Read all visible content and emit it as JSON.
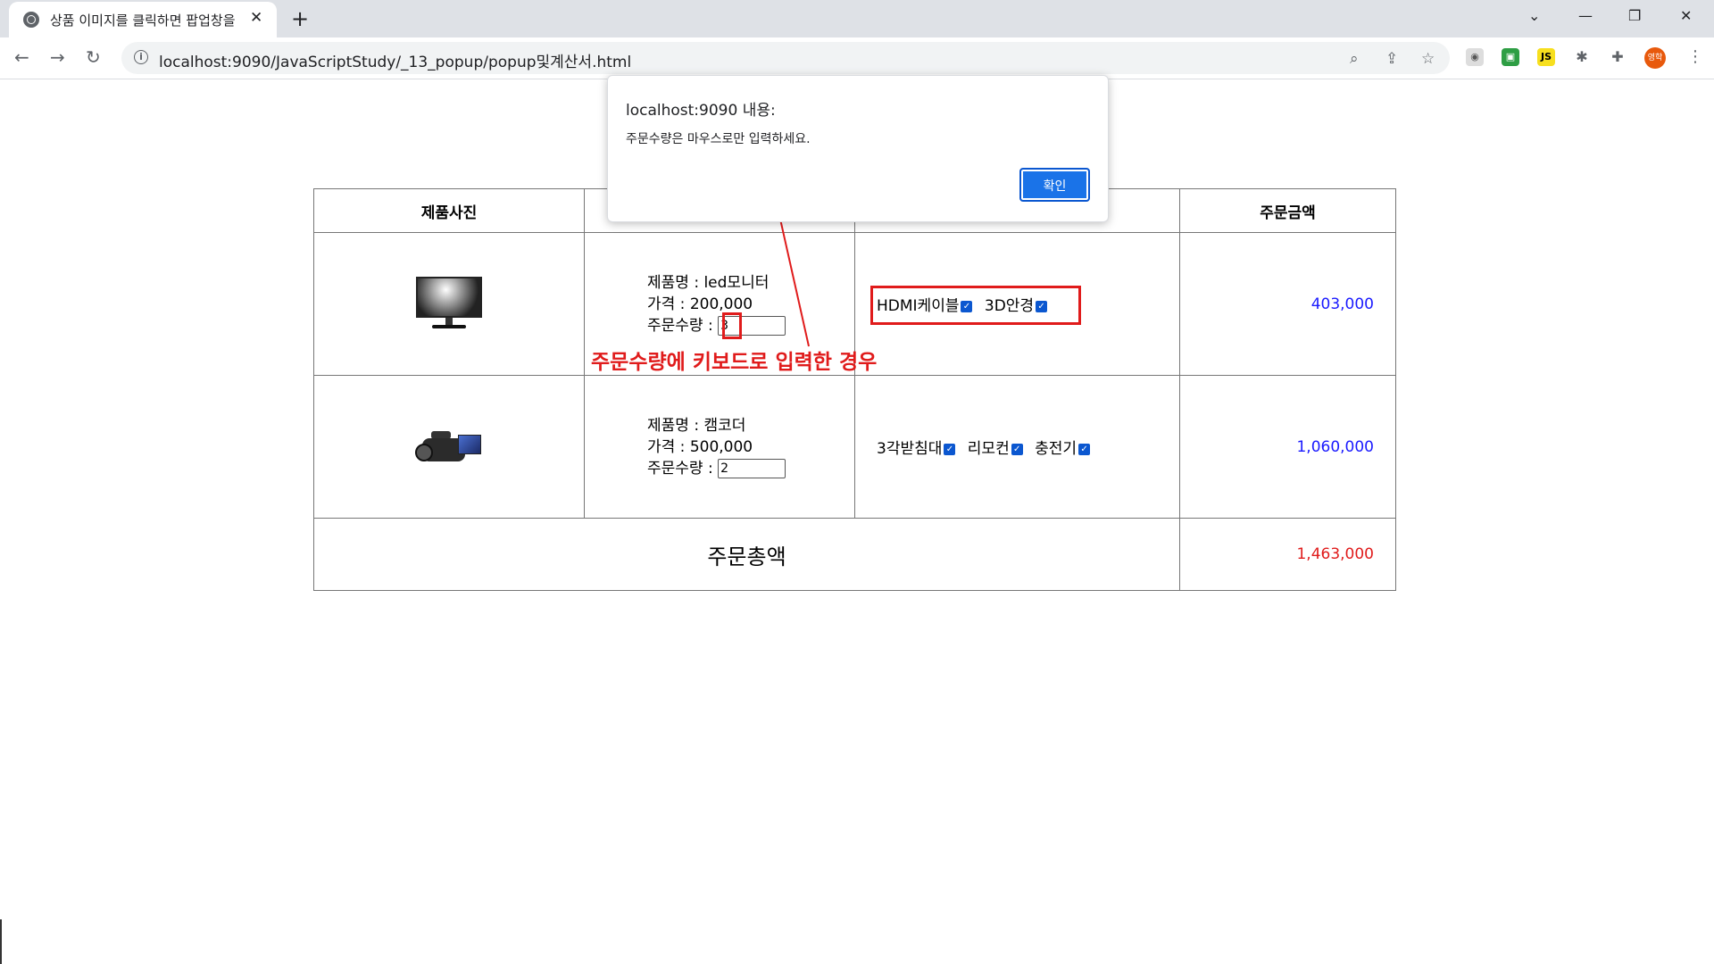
{
  "browser": {
    "tab_title": "상품 이미지를 클릭하면 팝업창을",
    "tab_close": "✕",
    "new_tab": "+",
    "url": "localhost:9090/JavaScriptStudy/_13_popup/popup및계산서.html",
    "window_controls": [
      "⌄",
      "—",
      "❐",
      "✕"
    ],
    "nav": {
      "back": "←",
      "forward": "→",
      "reload": "↻"
    },
    "profile_label": "영학",
    "extensions": [
      "ext-shield",
      "ext-green",
      "JS",
      "ext-bug",
      "puzzle-icon"
    ]
  },
  "dialog": {
    "title": "localhost:9090 내용:",
    "message": "주문수량은 마우스로만 입력하세요.",
    "ok_label": "확인"
  },
  "table": {
    "headers": [
      "제품사진",
      "",
      "",
      "주문금액"
    ],
    "rows": [
      {
        "image_icon": "monitor-icon",
        "name_line": "제품명 : led모니터",
        "price_line": "가격 : 200,000",
        "qty_label": "주문수량 :",
        "qty_value": "3",
        "options": [
          {
            "label": "HDMI케이블",
            "checked": true
          },
          {
            "label": "3D안경",
            "checked": true
          }
        ],
        "amount": "403,000"
      },
      {
        "image_icon": "camcorder-icon",
        "name_line": "제품명 : 캠코더",
        "price_line": "가격 : 500,000",
        "qty_label": "주문수량 :",
        "qty_value": "2",
        "options": [
          {
            "label": "3각받침대",
            "checked": true
          },
          {
            "label": "리모컨",
            "checked": true
          },
          {
            "label": "충전기",
            "checked": true
          }
        ],
        "amount": "1,060,000"
      }
    ],
    "total_label": "주문총액",
    "total_amount": "1,463,000"
  },
  "annotation": {
    "note": "주문수량에 키보드로 입력한 경우",
    "color": "#e01b1b"
  }
}
